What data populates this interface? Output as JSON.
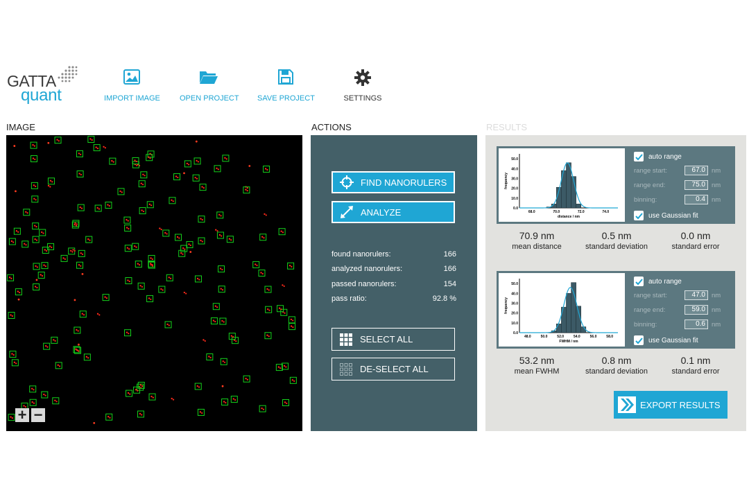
{
  "logo": {
    "line1": "GATTA",
    "line2": "quant"
  },
  "toolbar": {
    "import_image": "IMPORT IMAGE",
    "open_project": "OPEN PROJECT",
    "save_project": "SAVE PROJECT",
    "settings": "SETTINGS"
  },
  "sections": {
    "image": "IMAGE",
    "actions": "ACTIONS",
    "results": "RESULTS"
  },
  "image_view": {
    "zoom_in": "+",
    "zoom_out": "−"
  },
  "actions": {
    "find_nanorulers": "FIND NANORULERS",
    "analyze": "ANALYZE",
    "select_all": "SELECT ALL",
    "deselect_all": "DE-SELECT ALL",
    "stats": [
      {
        "label": "found nanorulers:",
        "value": "166"
      },
      {
        "label": "analyzed nanorulers:",
        "value": "166"
      },
      {
        "label": "passed nanorulers:",
        "value": "154"
      },
      {
        "label": "pass ratio:",
        "value": "92.8 %"
      }
    ]
  },
  "results": {
    "distance": {
      "auto_range": "auto range",
      "range_start_label": "range start:",
      "range_start": "67.0",
      "range_end_label": "range end:",
      "range_end": "75.0",
      "binning_label": "binning:",
      "binning": "0.4",
      "unit": "nm",
      "gaussian": "use Gaussian fit",
      "mean_value": "70.9 nm",
      "mean_label": "mean distance",
      "sd_value": "0.5 nm",
      "sd_label": "standard deviation",
      "se_value": "0.0 nm",
      "se_label": "standard error"
    },
    "fwhm": {
      "auto_range": "auto range",
      "range_start_label": "range start:",
      "range_start": "47.0",
      "range_end_label": "range end:",
      "range_end": "59.0",
      "binning_label": "binning:",
      "binning": "0.6",
      "unit": "nm",
      "gaussian": "use Gaussian fit",
      "mean_value": "53.2 nm",
      "mean_label": "mean FWHM",
      "sd_value": "0.8 nm",
      "sd_label": "standard deviation",
      "se_value": "0.1 nm",
      "se_label": "standard error"
    },
    "export": "EXPORT RESULTS"
  },
  "colors": {
    "accent": "#1fa6d4",
    "actions_bg": "#446068",
    "results_bg": "#e2e2df",
    "box_bg": "#5c7880"
  },
  "chart_data": [
    {
      "type": "bar",
      "xlabel": "distance / nm",
      "ylabel": "frequency",
      "xticks": [
        "68.0",
        "70.0",
        "72.0",
        "74.0"
      ],
      "yticks": [
        "0.0",
        "10.0",
        "20.0",
        "30.0",
        "40.0",
        "50.0"
      ],
      "xlim": [
        67.0,
        75.0
      ],
      "ylim": [
        0,
        55
      ],
      "bins": [
        69.4,
        69.8,
        70.2,
        70.6,
        71.0,
        71.4,
        71.8
      ],
      "values": [
        1,
        4,
        21,
        38,
        46,
        32,
        4
      ],
      "gaussian_fit": {
        "mean": 70.9,
        "sd": 0.5,
        "peak": 46
      }
    },
    {
      "type": "bar",
      "xlabel": "FWHM / nm",
      "ylabel": "frequency",
      "xticks": [
        "48.0",
        "50.0",
        "52.0",
        "54.0",
        "56.0",
        "58.0"
      ],
      "yticks": [
        "0.0",
        "10.0",
        "20.0",
        "30.0",
        "40.0",
        "50.0"
      ],
      "xlim": [
        47.0,
        59.0
      ],
      "ylim": [
        0,
        55
      ],
      "bins": [
        51.2,
        51.8,
        52.4,
        53.0,
        53.6,
        54.2,
        54.8
      ],
      "values": [
        2,
        9,
        26,
        40,
        51,
        27,
        6
      ],
      "gaussian_fit": {
        "mean": 53.2,
        "sd": 0.8,
        "peak": 46
      }
    }
  ]
}
